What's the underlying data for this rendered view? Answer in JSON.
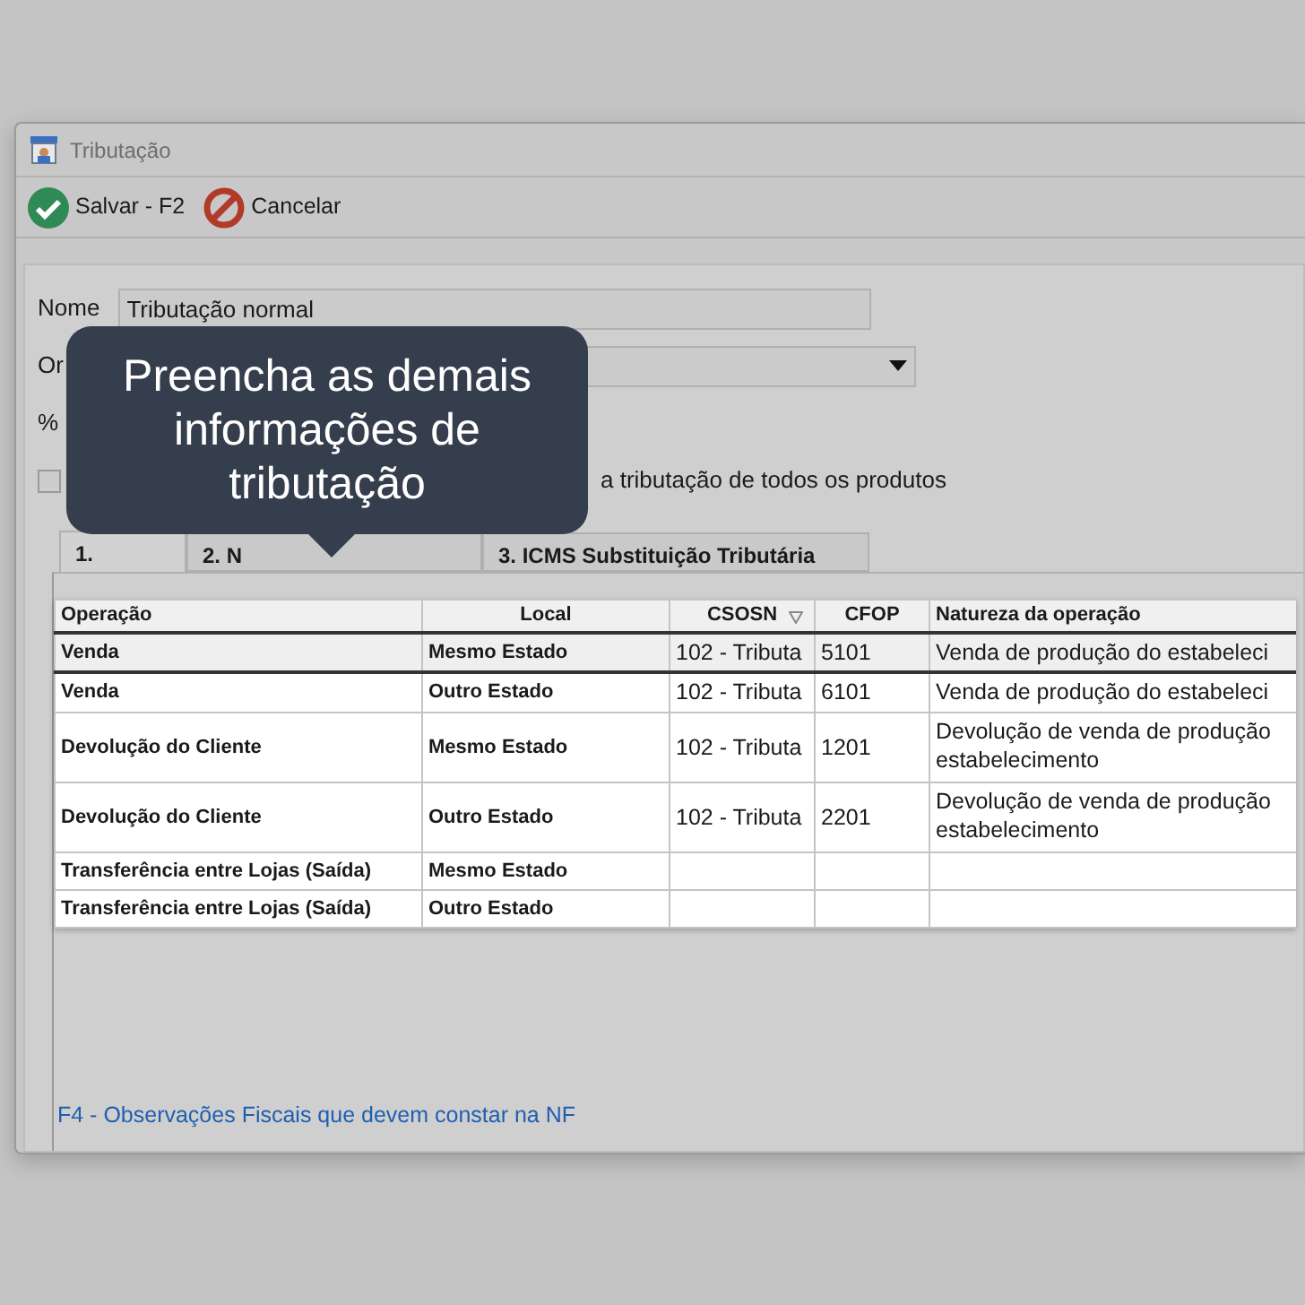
{
  "window": {
    "title": "Tributação"
  },
  "toolbar": [
    {
      "kind": "save",
      "label": "Salvar - F2"
    },
    {
      "kind": "cancel",
      "label": "Cancelar"
    }
  ],
  "form": {
    "name_label": "Nome",
    "name_value": "Tributação normal",
    "origin_label": "Or",
    "percent_label": "%",
    "checkbox": {
      "label": "a tributação de todos os produtos",
      "checked": false
    }
  },
  "tooltip": {
    "text": "Preencha as demais informações de tributação"
  },
  "tabs": [
    {
      "label": "1.",
      "selected": true
    },
    {
      "label": "2. N",
      "selected": false
    },
    {
      "label": "3. ICMS Substituição Tributária",
      "selected": false
    }
  ],
  "table": {
    "columns": [
      {
        "label": "Operação",
        "filter": false
      },
      {
        "label": "Local",
        "filter": false
      },
      {
        "label": "CSOSN",
        "filter": true
      },
      {
        "label": "CFOP",
        "filter": false
      },
      {
        "label": "Natureza da operação",
        "filter": false
      }
    ],
    "rows": [
      {
        "selected": true,
        "cells": [
          "Venda",
          "Mesmo Estado",
          "102 - Tributa",
          "5101",
          "Venda de produção do estabeleci"
        ]
      },
      {
        "selected": false,
        "cells": [
          "Venda",
          "Outro Estado",
          "102 - Tributa",
          "6101",
          "Venda de produção do estabeleci"
        ]
      },
      {
        "selected": false,
        "cells": [
          "Devolução do Cliente",
          "Mesmo Estado",
          "102 - Tributa",
          "1201",
          "Devolução de venda de produção estabelecimento"
        ]
      },
      {
        "selected": false,
        "cells": [
          "Devolução do Cliente",
          "Outro Estado",
          "102 - Tributa",
          "2201",
          "Devolução de venda de produção estabelecimento"
        ]
      },
      {
        "selected": false,
        "cells": [
          "Transferência entre Lojas (Saída)",
          "Mesmo Estado",
          "",
          "",
          ""
        ]
      },
      {
        "selected": false,
        "cells": [
          "Transferência entre Lojas (Saída)",
          "Outro Estado",
          "",
          "",
          ""
        ]
      }
    ]
  },
  "footer_link": "F4 - Observações Fiscais que devem constar na NF"
}
